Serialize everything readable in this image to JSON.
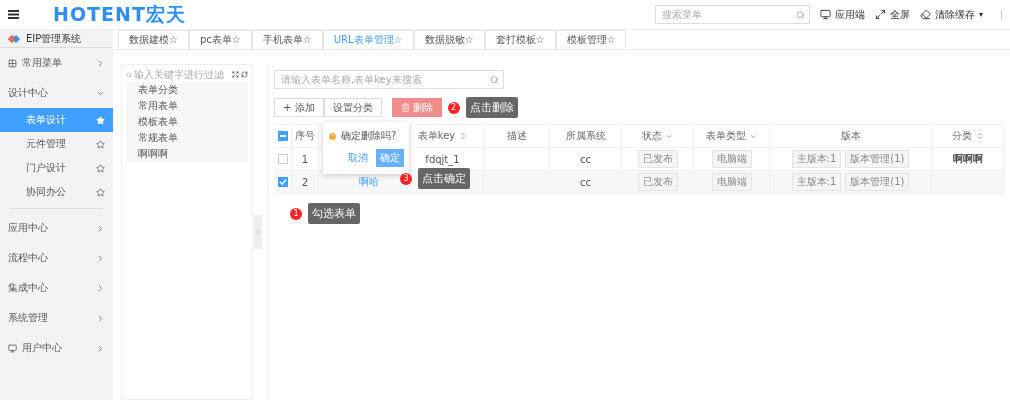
{
  "header": {
    "logo": "HOTENT宏天",
    "search": {
      "placeholder": "搜索菜单"
    },
    "actions": [
      {
        "kind": "monitor",
        "label": "应用端"
      },
      {
        "kind": "fullscreen",
        "label": "全屏"
      },
      {
        "kind": "clear",
        "label": "清除缓存",
        "caret": "▾"
      }
    ]
  },
  "sidebar": {
    "system": "EIP管理系统",
    "items": [
      {
        "kind": "grid",
        "label": "常用菜单",
        "expanded": false
      },
      {
        "kind": "plain",
        "label": "设计中心",
        "expanded": true,
        "children": [
          {
            "label": "表单设计",
            "selected": true
          },
          {
            "label": "元件管理",
            "selected": false
          },
          {
            "label": "门户设计",
            "selected": false
          },
          {
            "label": "协同办公",
            "selected": false
          }
        ]
      },
      {
        "kind": "plain",
        "label": "应用中心",
        "expanded": false
      },
      {
        "kind": "plain",
        "label": "流程中心",
        "expanded": false
      },
      {
        "kind": "plain",
        "label": "集成中心",
        "expanded": false
      },
      {
        "kind": "plain",
        "label": "系统管理",
        "expanded": false
      },
      {
        "kind": "monitor",
        "label": "用户中心",
        "expanded": false
      }
    ]
  },
  "tabs": [
    {
      "label": "数据建模☆",
      "selected": false
    },
    {
      "label": "pc表单☆",
      "selected": false
    },
    {
      "label": "手机表单☆",
      "selected": false
    },
    {
      "label": "URL表单管理☆",
      "selected": true
    },
    {
      "label": "数据脱敏☆",
      "selected": false
    },
    {
      "label": "套打模板☆",
      "selected": false
    },
    {
      "label": "模板管理☆",
      "selected": false
    }
  ],
  "tree": {
    "placeholder": "输入关键字进行过滤",
    "nodes": [
      "表单分类",
      "常用表单",
      "模板表单",
      "常规表单",
      "啊啊啊"
    ]
  },
  "search": {
    "placeholder": "请输入表单名称,表单key来搜索"
  },
  "toolbar": {
    "add": "+ 添加",
    "classify": "设置分类",
    "delete": "删除"
  },
  "table": {
    "columns": [
      {
        "label": "序号"
      },
      {},
      {
        "label": "表单key",
        "sortable": true
      },
      {
        "label": "描述"
      },
      {
        "label": "所属系统"
      },
      {
        "label": "状态",
        "filter": true
      },
      {
        "label": "表单类型",
        "filter": true
      },
      {
        "label": "版本"
      },
      {
        "label": "分类",
        "sortable": true
      }
    ],
    "header_indeterminate": true,
    "rows": [
      {
        "checked": false,
        "index": "1",
        "key": "fdqjt_1",
        "system": "cc",
        "status": "已发布",
        "type": "电脑端",
        "version": "主版本:1",
        "manage": "版本管理(1)",
        "category": "啊啊啊"
      },
      {
        "checked": true,
        "index": "2",
        "name": "啊哈",
        "system": "cc",
        "status": "已发布",
        "type": "电脑端",
        "version": "主版本:1",
        "manage": "版本管理(1)"
      }
    ]
  },
  "popover": {
    "message": "确定删除吗?",
    "cancel": "取消",
    "confirm": "确定"
  },
  "callouts": [
    {
      "number": "2",
      "text": "点击删除"
    },
    {
      "number": "3",
      "text": "点击确定"
    },
    {
      "number": "1",
      "text": "勾选表单"
    }
  ]
}
